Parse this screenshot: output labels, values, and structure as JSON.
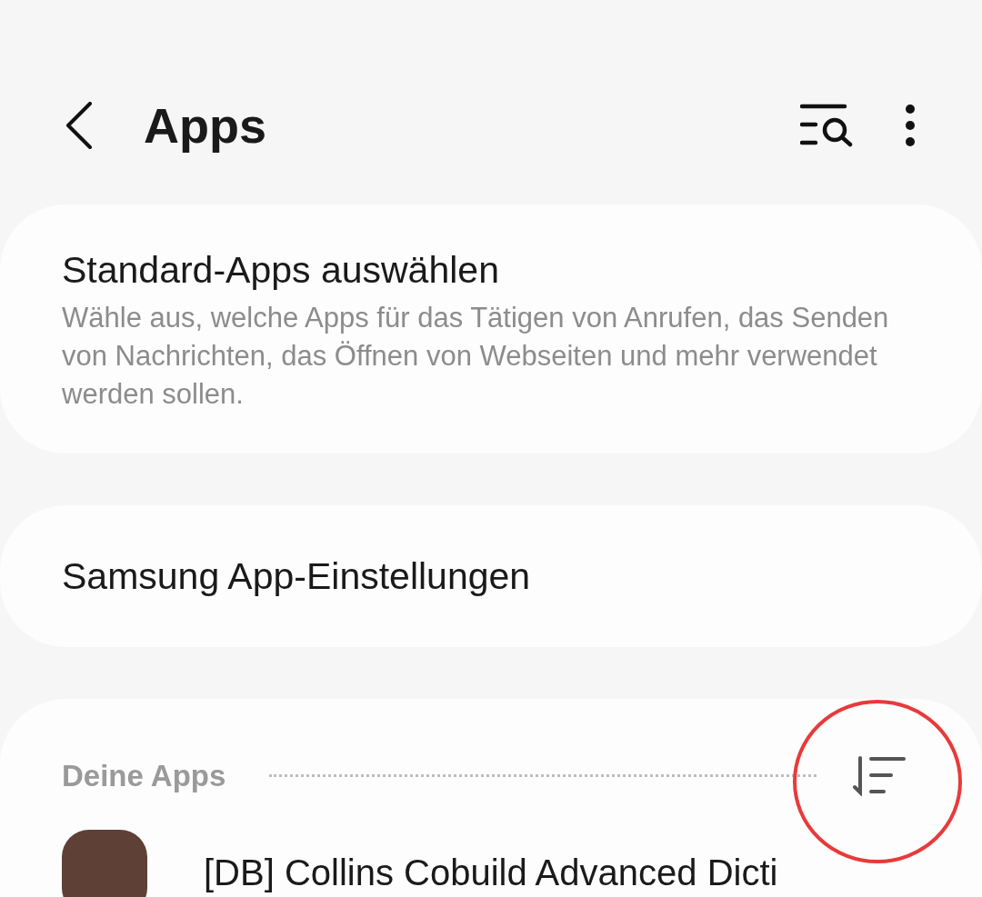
{
  "header": {
    "title": "Apps"
  },
  "cards": [
    {
      "title": "Standard-Apps auswählen",
      "description": "Wähle aus, welche Apps für das Tätigen von Anrufen, das Senden von Nachrichten, das Öffnen von Webseiten und mehr verwendet werden sollen."
    },
    {
      "title": "Samsung App-Einstellungen"
    }
  ],
  "apps_section": {
    "heading": "Deine Apps",
    "apps": [
      {
        "name": "[DB] Collins Cobuild Advanced Dicti"
      }
    ]
  }
}
